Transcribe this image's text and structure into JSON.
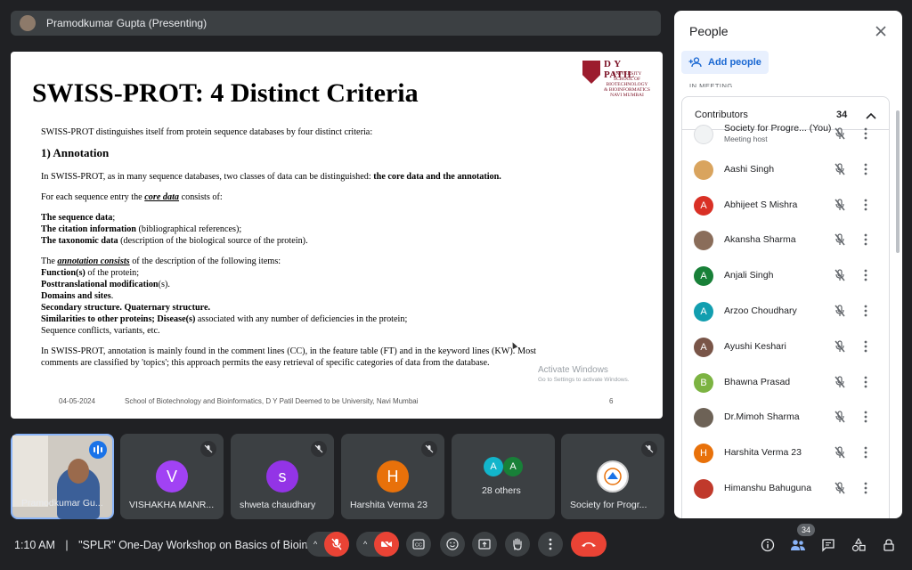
{
  "presenter": {
    "label": "Pramodkumar Gupta (Presenting)"
  },
  "slide": {
    "logo_title": "D Y PATIL",
    "logo_sub": "UNIVERSITY SCHOOL OF BIOTECHNOLOGY & BIOINFORMATICS NAVI MUMBAI",
    "title": "SWISS-PROT: 4 Distinct Criteria",
    "intro": "SWISS-PROT distinguishes itself from protein sequence databases by four distinct criteria:",
    "heading": "1) Annotation",
    "p1_a": "In SWISS-PROT, as in many sequence databases, two classes of data can be distinguished: ",
    "p1_b": "the core data and the annotation.",
    "p2_a": "For each sequence entry the ",
    "p2_b": "core data",
    "p2_c": " consists of:",
    "core1_b": "The sequence data",
    "core1_r": ";",
    "core2_b": "The citation information",
    "core2_r": " (bibliographical references);",
    "core3_b": "The taxonomic data",
    "core3_r": " (description of the biological source of the protein).",
    "ann_a": "The ",
    "ann_b": "annotation consists",
    "ann_c": " of the description of the following items:",
    "i1_b": "Function(s)",
    "i1_r": " of the protein;",
    "i2_b": "Posttranslational modification",
    "i2_r": "(s).",
    "i3_b": "Domains and sites",
    "i3_r": ".",
    "i4_b": "Secondary structure. Quaternary structure.",
    "i5_b": "Similarities to other proteins; Disease(s)",
    "i5_r": " associated with any number of deficiencies in the protein;",
    "i6_r": "Sequence conflicts, variants, etc.",
    "last": "In SWISS-PROT, annotation is mainly found in the comment lines (CC), in the feature table (FT) and in the keyword lines (KW). Most comments are classified by 'topics'; this approach permits the easy retrieval of specific categories of data from the database.",
    "footer_date": "04-05-2024",
    "footer_school": "School of Biotechnology and Bioinformatics, D Y Patil Deemed to be University, Navi Mumbai",
    "footer_page": "6",
    "watermark_1": "Activate Windows",
    "watermark_2": "Go to Settings to activate Windows."
  },
  "tiles": [
    {
      "name": "Pramodkumar Gu..."
    },
    {
      "name": "VISHAKHA MANR...",
      "initial": "V",
      "color": "#a142f4"
    },
    {
      "name": "shweta chaudhary",
      "initial": "s",
      "color": "#9334e6"
    },
    {
      "name": "Harshita Verma 23",
      "initial": "H",
      "color": "#e8710a"
    },
    {
      "name": "28 others",
      "a1": "A",
      "a2": "A",
      "c1": "#12b5cb",
      "c2": "#188038"
    },
    {
      "name": "Society for Progr..."
    }
  ],
  "bottom": {
    "time": "1:10 AM",
    "separator": "|",
    "meeting_title": "\"SPLR\" One-Day Workshop on Basics of Bioinf...",
    "people_count": "34"
  },
  "panel": {
    "title": "People",
    "add_label": "Add people",
    "in_meeting": "IN MEETING",
    "section": "Contributors",
    "count": "34",
    "people": [
      {
        "name": "Society for Progre... (You)",
        "sub": "Meeting host",
        "initial": "",
        "color": "#f1f3f4"
      },
      {
        "name": "Aashi Singh",
        "initial": "",
        "color": "#d9a45e"
      },
      {
        "name": "Abhijeet S Mishra",
        "initial": "A",
        "color": "#d93025"
      },
      {
        "name": "Akansha Sharma",
        "initial": "",
        "color": "#8a6d5a"
      },
      {
        "name": "Anjali Singh",
        "initial": "A",
        "color": "#188038"
      },
      {
        "name": "Arzoo Choudhary",
        "initial": "A",
        "color": "#129eaf"
      },
      {
        "name": "Ayushi Keshari",
        "initial": "A",
        "color": "#795548"
      },
      {
        "name": "Bhawna Prasad",
        "initial": "B",
        "color": "#7cb342"
      },
      {
        "name": "Dr.Mimoh Sharma",
        "initial": "",
        "color": "#6d6256"
      },
      {
        "name": "Harshita Verma 23",
        "initial": "H",
        "color": "#e8710a"
      },
      {
        "name": "Himanshu Bahuguna",
        "initial": "",
        "color": "#c0392b"
      }
    ]
  }
}
